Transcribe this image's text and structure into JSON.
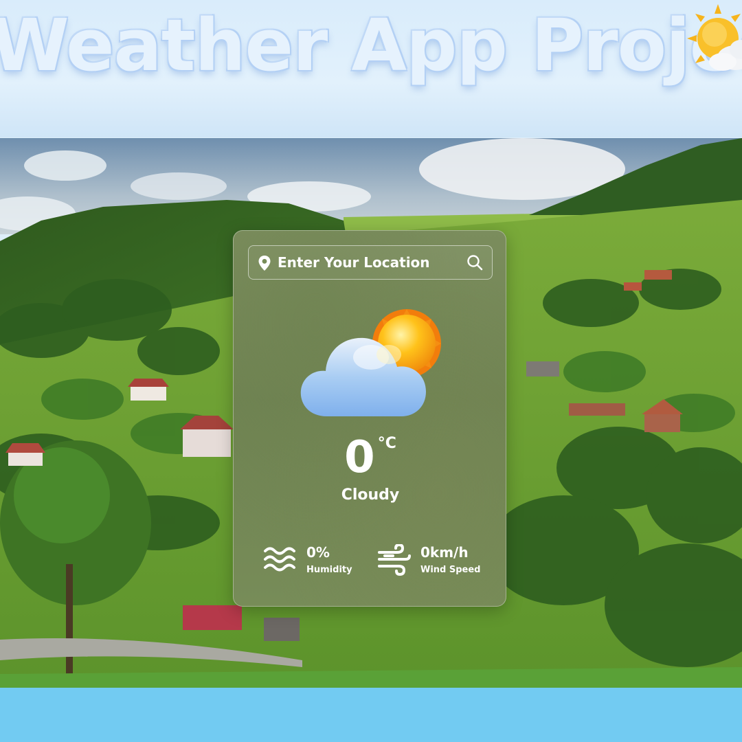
{
  "banner": {
    "title": "Weather App Project",
    "emoji_icon": "sun-behind-cloud-icon"
  },
  "search": {
    "placeholder": "Enter Your Location",
    "value": ""
  },
  "current": {
    "icon": "cloud-sun-icon",
    "temperature": "0",
    "unit": "°C",
    "condition": "Cloudy"
  },
  "details": {
    "humidity": {
      "value": "0%",
      "label": "Humidity",
      "icon": "humidity-waves-icon"
    },
    "wind": {
      "value": "0km/h",
      "label": "Wind Speed",
      "icon": "wind-icon"
    }
  },
  "colors": {
    "banner_bg": "#dcedfb",
    "title_outline": "#b6d2f5",
    "bottom_bar": "#72cbf2",
    "card_tint": "#778c58",
    "text": "#ffffff"
  }
}
